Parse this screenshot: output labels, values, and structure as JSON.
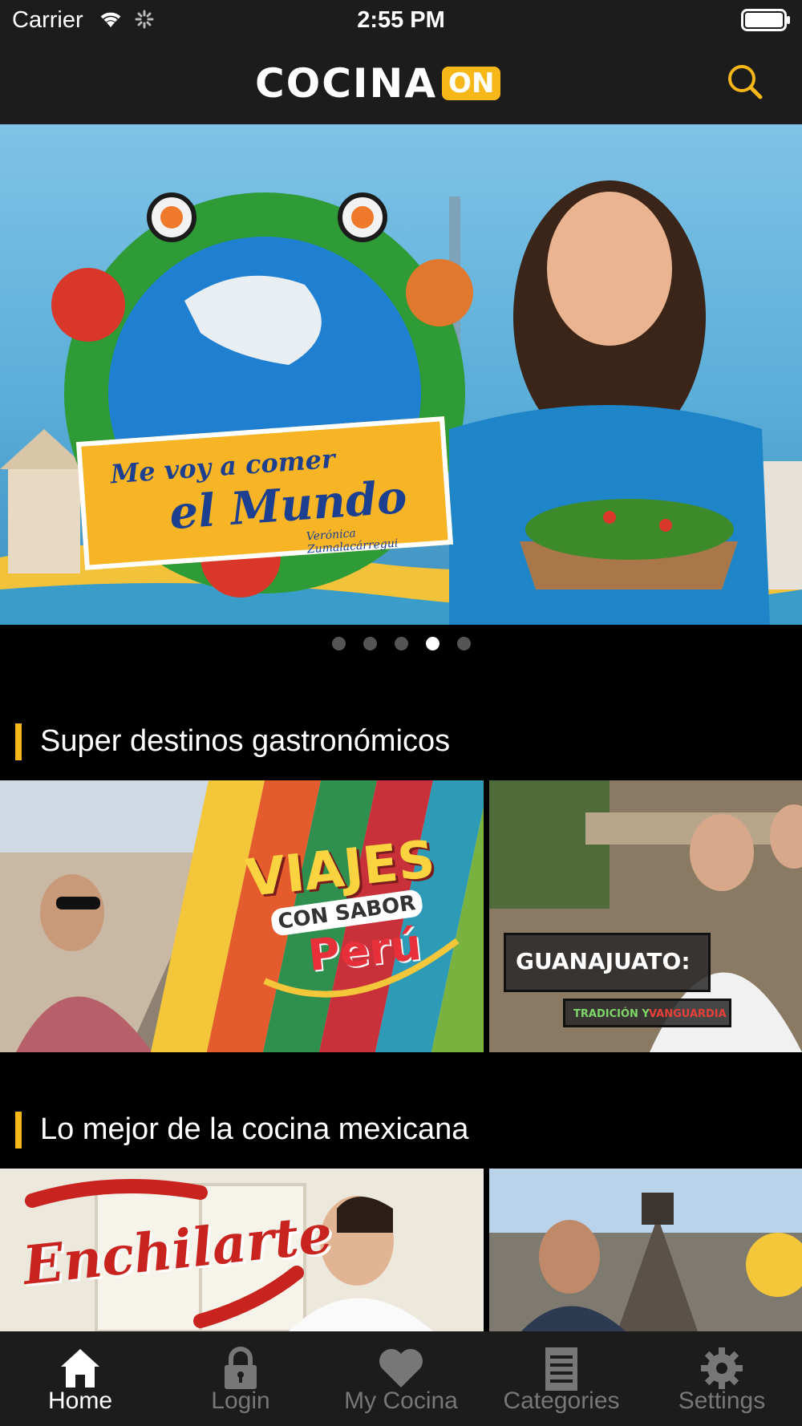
{
  "status_bar": {
    "carrier": "Carrier",
    "time": "2:55 PM"
  },
  "header": {
    "logo_text": "COCINA",
    "logo_badge": "ON"
  },
  "hero": {
    "banner_line1": "Me voy a comer",
    "banner_line2": "el Mundo",
    "banner_line3": "Verónica Zumalacárregui",
    "page_count": 5,
    "active_page": 4
  },
  "sections": [
    {
      "title": "Super destinos gastronómicos",
      "cards": [
        {
          "line1": "VIAJES",
          "line2": "CON SABOR",
          "line3": "Perú"
        },
        {
          "line1": "GUANAJUATO:",
          "line2": "TRADICIÓN Y",
          "line3": "VANGUARDIA"
        }
      ]
    },
    {
      "title": "Lo mejor de la cocina mexicana",
      "cards": [
        {
          "line1": "Enchilarte"
        },
        {
          "line1": ""
        }
      ]
    }
  ],
  "tab_bar": {
    "tabs": [
      {
        "label": "Home",
        "icon": "home-icon",
        "active": true
      },
      {
        "label": "Login",
        "icon": "lock-icon",
        "active": false
      },
      {
        "label": "My Cocina",
        "icon": "heart-icon",
        "active": false
      },
      {
        "label": "Categories",
        "icon": "list-icon",
        "active": false
      },
      {
        "label": "Settings",
        "icon": "gear-icon",
        "active": false
      }
    ]
  },
  "colors": {
    "accent": "#f7b718",
    "bar": "#1c1c1c",
    "background": "#000000",
    "inactive": "#777777"
  }
}
